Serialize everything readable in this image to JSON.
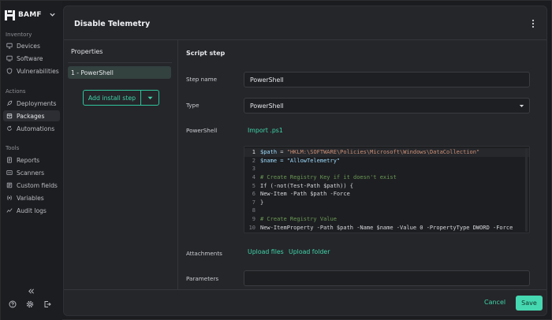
{
  "app": {
    "name": "BAMF"
  },
  "sidebar": {
    "sections": [
      {
        "label": "Inventory",
        "items": [
          {
            "label": "Devices",
            "icon": "monitor-icon"
          },
          {
            "label": "Software",
            "icon": "display-icon"
          },
          {
            "label": "Vulnerabilities",
            "icon": "shield-icon"
          }
        ]
      },
      {
        "label": "Actions",
        "items": [
          {
            "label": "Deployments",
            "icon": "rocket-icon"
          },
          {
            "label": "Packages",
            "icon": "package-icon",
            "active": true
          },
          {
            "label": "Automations",
            "icon": "refresh-icon"
          }
        ]
      },
      {
        "label": "Tools",
        "items": [
          {
            "label": "Reports",
            "icon": "report-icon"
          },
          {
            "label": "Scanners",
            "icon": "scanner-icon"
          },
          {
            "label": "Custom fields",
            "icon": "fields-icon"
          },
          {
            "label": "Variables",
            "icon": "variables-icon"
          },
          {
            "label": "Audit logs",
            "icon": "audit-icon"
          }
        ]
      }
    ]
  },
  "header": {
    "title": "Disable Telemetry"
  },
  "properties": {
    "title": "Properties",
    "steps": [
      "1 - PowerShell"
    ],
    "add_step_label": "Add install step"
  },
  "form": {
    "section_title": "Script step",
    "step_name_label": "Step name",
    "step_name_value": "PowerShell",
    "type_label": "Type",
    "type_value": "PowerShell",
    "powershell_label": "PowerShell",
    "import_label": "Import .ps1",
    "attachments_label": "Attachments",
    "upload_files_label": "Upload files",
    "upload_folder_label": "Upload folder",
    "parameters_label": "Parameters",
    "parameters_value": ""
  },
  "code_lines": [
    "$path = \"HKLM:\\SOFTWARE\\Policies\\Microsoft\\Windows\\DataCollection\"",
    "$name = \"AllowTelemetry\"",
    "",
    "# Create Registry Key if it doesn't exist",
    "If (-not(Test-Path $path)) {",
    "New-Item -Path $path -Force",
    "}",
    "",
    "# Create Registry Value",
    "New-ItemProperty -Path $path -Name $name -Value 0 -PropertyType DWORD -Force"
  ],
  "footer": {
    "cancel_label": "Cancel",
    "save_label": "Save"
  },
  "colors": {
    "accent": "#3fd5ab",
    "save_bg": "#46d8b1",
    "active_step_bg": "#33413f"
  }
}
